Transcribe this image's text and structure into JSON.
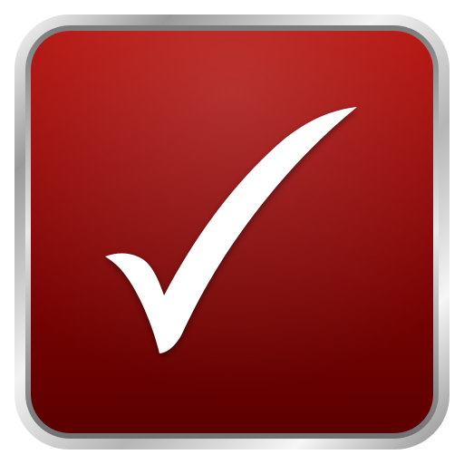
{
  "icon": {
    "name": "checkmark-icon",
    "colors": {
      "tile_top": "#9d0705",
      "tile_bottom": "#5e0000",
      "bezel_light": "#f7f7f7",
      "bezel_mid": "#c7c7c7",
      "bezel_dark": "#8a8a8a",
      "check": "#ffffff",
      "background": "#ffffff"
    }
  }
}
